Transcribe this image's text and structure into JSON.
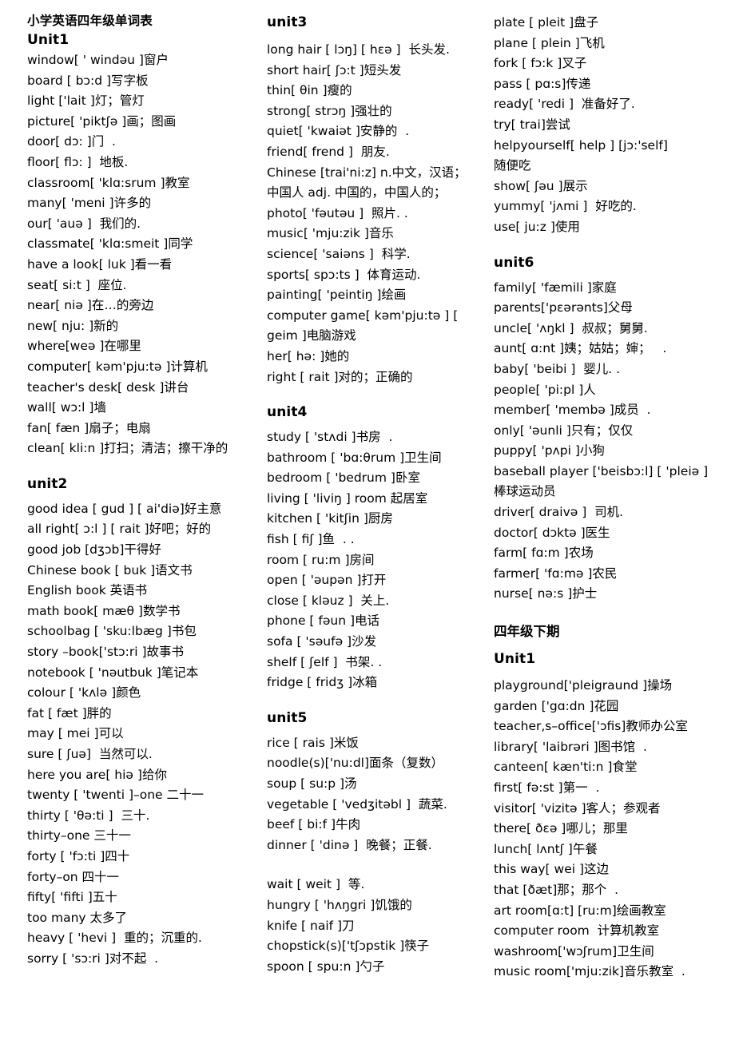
{
  "document": {
    "title": "小学英语四年级单词表"
  },
  "column1": {
    "unit1": {
      "heading": "Unit1",
      "entries": [
        "window[ ' windəu ]窗户",
        "board [ bɔ:d ]写字板",
        "light ['lait ]灯；管灯",
        "picture[ 'piktʃə ]画；图画",
        "door[ dɔ: ]门  .",
        "floor[ flɔ: ]  地板.",
        "classroom[ 'klɑ:srum ]教室",
        "many[ 'meni ]许多的",
        "our[ 'auə ]  我们的.",
        "classmate[ 'klɑ:smeit ]同学",
        "have a look[ luk ]看一看",
        "seat[ si:t ]  座位.",
        "near[ niə ]在…的旁边",
        "new[ nju: ]新的",
        "where[weə ]在哪里",
        "computer[ kəm'pju:tə ]计算机",
        "teacher's desk[ desk ]讲台",
        "wall[ wɔ:l ]墙",
        "fan[ fæn ]扇子；电扇",
        "clean[ kli:n ]打扫；清洁；擦干净的"
      ]
    },
    "unit2": {
      "heading": "unit2",
      "entries": [
        "good idea [ gud ] [ ai'diə]好主意",
        "all right[ ɔ:l ] [ rait ]好吧；好的",
        "good job [dʒɔb]干得好",
        "Chinese book [ buk ]语文书",
        "English book 英语书",
        "math book[ mæθ ]数学书",
        "schoolbag [ 'sku:lbæg ]书包",
        "story –book['stɔ:ri ]故事书",
        "notebook [ 'nəutbuk ]笔记本",
        "colour [ 'kʌlə ]颜色",
        "fat [ fæt ]胖的",
        "may [ mei ]可以",
        "sure [ ʃuə]  当然可以.",
        "here you are[ hiə ]给你",
        "twenty [ 'twenti ]–one 二十一",
        "thirty [ 'θə:ti ]  三十.",
        "thirty–one 三十一",
        "forty [ 'fɔ:ti ]四十",
        "forty–on 四十一",
        "fifty[ 'fifti ]五十",
        "too many 太多了",
        "heavy [ 'hevi ]  重的；沉重的.",
        "sorry [ 'sɔ:ri ]对不起  ."
      ]
    }
  },
  "column2": {
    "unit3": {
      "heading": "unit3",
      "entries": [
        "long hair [ lɔŋ] [ hɛə ]  长头发.",
        "short hair[ ʃɔ:t ]短头发",
        "thin[ θin ]瘦的",
        "strong[ strɔŋ ]强壮的",
        "quiet[ 'kwaiət ]安静的  .",
        "friend[ frend ]  朋友.",
        "Chinese [trai'ni:z] n.中文，汉语；",
        "中国人 adj. 中国的，中国人的；",
        "photo[ 'fəutəu ]  照片. .",
        "music[ 'mju:zik ]音乐",
        "science[ 'saiəns ]  科学.",
        "sports[ spɔ:ts ]  体育运动.",
        "painting[ 'peintiŋ ]绘画",
        "computer game[ kəm'pju:tə ] [",
        "geim ]电脑游戏",
        "her[ hə: ]她的",
        "right [ rait ]对的；正确的"
      ]
    },
    "unit4": {
      "heading": "unit4",
      "entries": [
        "study [ 'stʌdi ]书房  .",
        "bathroom [ 'bɑ:θrum ]卫生间",
        "bedroom [ 'bedrum ]卧室",
        "living [ 'liviŋ ] room 起居室",
        "kitchen [ 'kitʃin ]厨房",
        "fish [ fiʃ ]鱼  . .",
        "room [ ru:m ]房间",
        "open [ 'əupən ]打开",
        "close [ kləuz ]  关上.",
        "phone [ fəun ]电话",
        "sofa [ 'səufə ]沙发",
        "shelf [ ʃelf ]  书架. .",
        "fridge [ fridʒ ]冰箱"
      ]
    },
    "unit5": {
      "heading": "unit5",
      "entries": [
        "rice [ rais ]米饭",
        "noodle(s)['nu:dl]面条（复数）",
        "soup [ su:p ]汤",
        "vegetable [ 'vedʒitəbl ]  蔬菜.",
        "beef [ bi:f ]牛肉",
        "dinner [ 'dinə ]  晚餐；正餐."
      ],
      "entries_after_gap": [
        "wait [ weit ]  等.",
        "hungry [ 'hʌŋgri ]饥饿的",
        "knife [ naif ]刀",
        "chopstick(s)['tʃɔpstik ]筷子",
        "spoon [ spu:n ]勺子"
      ]
    }
  },
  "column3": {
    "unit5_continued": {
      "entries": [
        "plate [ pleit ]盘子",
        "plane [ plein ]飞机",
        "fork [ fɔ:k ]叉子",
        "pass [ pɑ:s]传递",
        "ready[ 'redi ]  准备好了.",
        "try[ trai]尝试",
        "helpyourself[ help ] [jɔ:'self]",
        "随便吃",
        "show[ ʃəu ]展示",
        "yummy[ 'jʌmi ]  好吃的.",
        "use[ ju:z ]使用"
      ]
    },
    "unit6": {
      "heading": "unit6",
      "entries": [
        "family[ 'fæmili ]家庭",
        "parents['pɛərənts]父母",
        "uncle[ 'ʌŋkl ]  叔叔；舅舅.",
        "aunt[ ɑ:nt ]姨；姑姑；婶；   .",
        "baby[ 'beibi ]  婴儿. .",
        "people[ 'pi:pl ]人",
        "member[ 'membə ]成员  .",
        "only[ 'əunli ]只有；仅仅",
        "puppy[ 'pʌpi ]小狗",
        "baseball player ['beisbɔ:l] [ 'pleiə ]",
        "棒球运动员",
        "driver[ draivə ]  司机.",
        "doctor[ dɔktə ]医生",
        "farm[ fɑ:m ]农场",
        "farmer[ 'fɑ:mə ]农民",
        "nurse[ nə:s ]护士"
      ]
    },
    "term2": {
      "heading": "四年级下期",
      "unit1": {
        "heading": "Unit1",
        "entries": [
          "playground['pleigraund ]操场",
          "garden ['gɑ:dn ]花园",
          "teacher,s–office['ɔfis]教师办公室",
          "library[ 'laibrəri ]图书馆  .",
          "canteen[ kæn'ti:n ]食堂",
          "first[ fə:st ]第一  .",
          "visitor[ 'vizitə ]客人；参观者",
          "there[ ðɛə ]哪儿；那里",
          "lunch[ lʌntʃ ]午餐",
          "this way[ wei ]这边",
          "that [ðæt]那；那个  .",
          "art room[ɑ:t] [ru:m]绘画教室",
          "computer room  计算机教室",
          "washroom['wɔʃrum]卫生间",
          "music room['mju:zik]音乐教室  ."
        ]
      }
    }
  }
}
